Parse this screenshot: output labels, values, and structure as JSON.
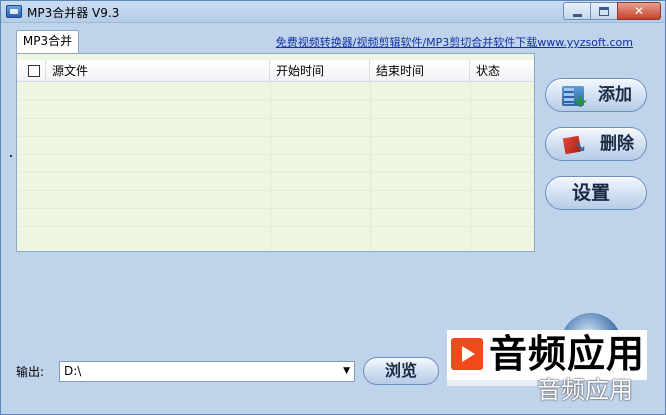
{
  "window": {
    "title": "MP3合并器 V9.3",
    "close_glyph": "✕"
  },
  "tab": {
    "label": "MP3合并"
  },
  "top_link": "免费视频转换器/视频剪辑软件/MP3剪切合并软件下载www.yyzsoft.com",
  "table": {
    "columns": [
      "源文件",
      "开始时间",
      "结束时间",
      "状态"
    ]
  },
  "buttons": {
    "add": "添加",
    "delete": "删除",
    "settings": "设置",
    "browse": "浏览"
  },
  "output": {
    "label": "输出:",
    "value": "D:\\",
    "arrow": "▼"
  },
  "watermark": {
    "title": "音频应用",
    "subtitle": "音频应用"
  },
  "colors": {
    "table_bg": "#eef6e2",
    "window_bg": "#bfd3ea",
    "link": "#1330a8",
    "close_red": "#c7402c"
  }
}
